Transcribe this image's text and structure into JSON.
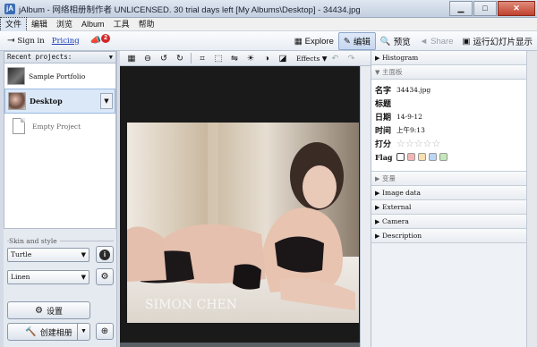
{
  "window": {
    "title": "jAlbum - 网络相册制作者 UNLICENSED. 30 trial days left [My Albums\\Desktop] - 34434.jpg",
    "app_icon": "jA"
  },
  "menu": [
    "文件",
    "编辑",
    "浏览",
    "Album",
    "工具",
    "帮助"
  ],
  "toolbar": {
    "sign_in": "Sign in",
    "pricing": "Pricing",
    "notification_count": "2",
    "modes": {
      "explore": "Explore",
      "edit": "编辑",
      "preview": "预览",
      "share": "Share",
      "slideshow": "运行幻灯片显示"
    }
  },
  "left_panel": {
    "recent_header": "Recent projects:",
    "projects": [
      "Sample Portfolio",
      "Desktop",
      "Empty Project"
    ],
    "skin_label": "Skin and style",
    "skin": "Turtle",
    "style": "Linen",
    "settings_label": "设置",
    "create_label": "创建相册"
  },
  "editor": {
    "effects_label": "Effects"
  },
  "photo": {
    "watermark": "SIMON CHEN"
  },
  "right_panel": {
    "histogram": "Histogram",
    "main_panel": "主面板",
    "info": {
      "name_key": "名字",
      "name_val": "34434.jpg",
      "title_key": "标题",
      "title_val": "",
      "date_key": "日期",
      "date_val": "14-9-12",
      "time_key": "时间",
      "time_val": "上午9:13",
      "rating_key": "打分",
      "flag_key": "Flag"
    },
    "sections": [
      "变量",
      "Image data",
      "External",
      "Camera",
      "Description"
    ]
  },
  "colors": {
    "selected": "#dbe8f8",
    "badge": "#d3262a",
    "link": "#1f3fb7"
  },
  "icons": {
    "flag_colors": [
      "#ffffff",
      "#f3b6b6",
      "#f6dfb0",
      "#bcd6f3",
      "#c4e8b9"
    ]
  }
}
